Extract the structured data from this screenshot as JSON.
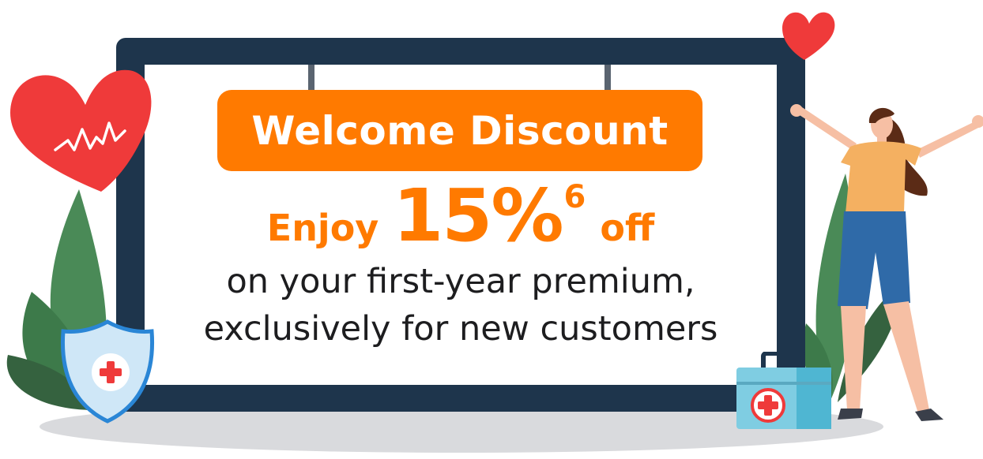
{
  "promo": {
    "banner_title": "Welcome Discount",
    "offer_prefix": "Enjoy",
    "offer_value": "15%",
    "offer_footnote": "6",
    "offer_suffix": "off",
    "description_line1": "on your first-year premium,",
    "description_line2": "exclusively for new customers"
  },
  "icons": [
    "heart-icon",
    "heartbeat-icon",
    "shield-cross-icon",
    "first-aid-kit-icon",
    "small-heart-icon"
  ],
  "colors": {
    "accent": "#ff7a00",
    "board": "#1e354c",
    "heart": "#ef3a3a",
    "leaf": "#4a8a57",
    "text": "#1d1d1f"
  }
}
